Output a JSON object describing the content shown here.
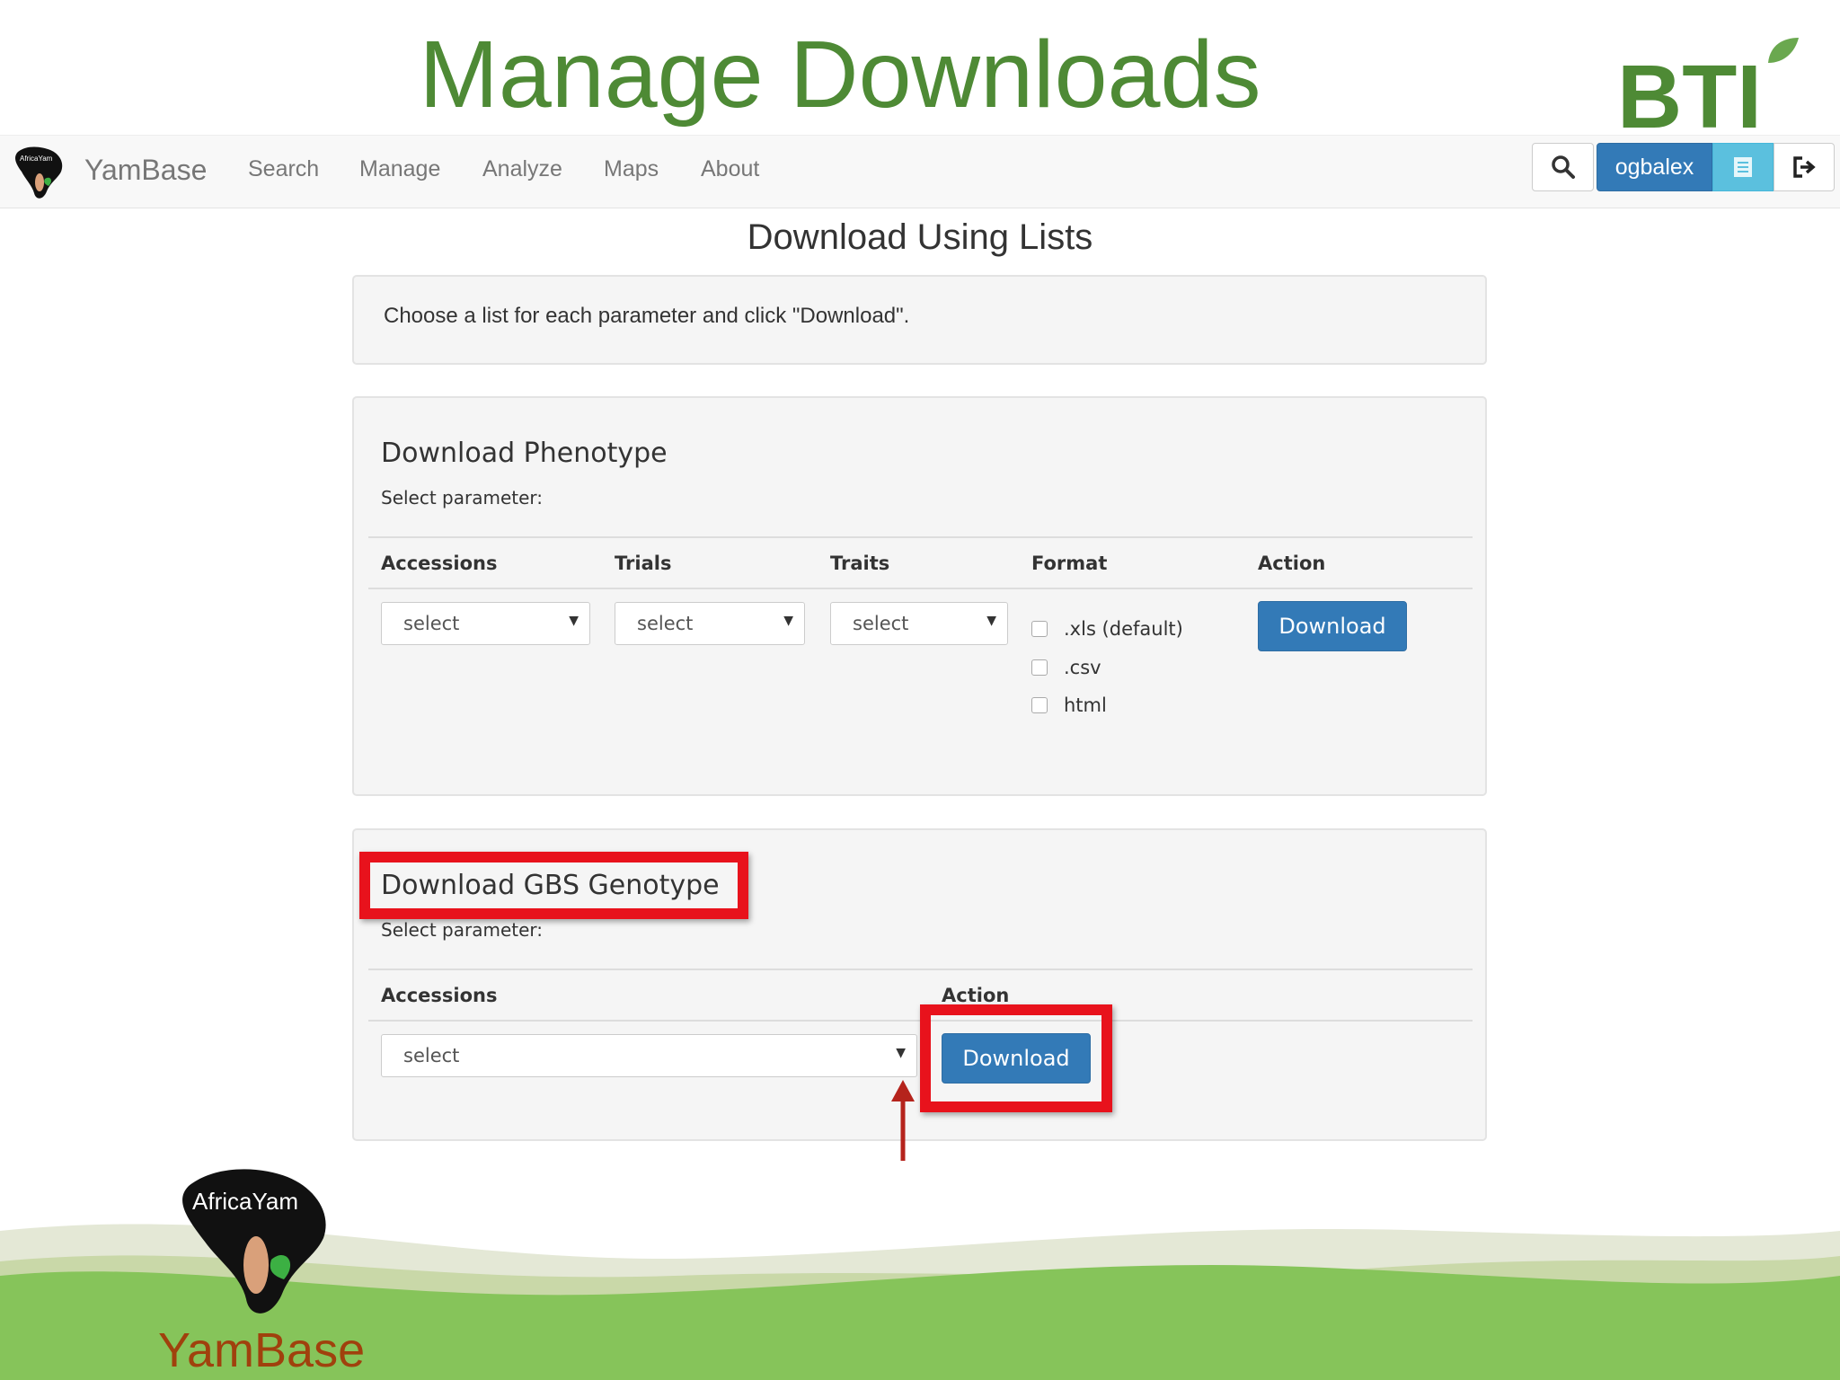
{
  "slide": {
    "title": "Manage Downloads",
    "logo_text": "BTI",
    "footer_label": "YamBase",
    "footer_logo_text": "AfricaYam"
  },
  "navbar": {
    "logo_text": "AfricaYam",
    "brand": "YamBase",
    "links": [
      "Search",
      "Manage",
      "Analyze",
      "Maps",
      "About"
    ],
    "user": "ogbalex",
    "icons": [
      "search-icon",
      "notes-icon",
      "logout-icon"
    ]
  },
  "page": {
    "heading": "Download Using Lists",
    "info": "Choose a list for each parameter and click \"Download\"."
  },
  "phenotype": {
    "title": "Download Phenotype",
    "subtitle": "Select parameter:",
    "columns": [
      "Accessions",
      "Trials",
      "Traits",
      "Format",
      "Action"
    ],
    "selects": [
      "select",
      "select",
      "select"
    ],
    "formats": [
      ".xls (default)",
      ".csv",
      "html"
    ],
    "action_label": "Download"
  },
  "genotype": {
    "title": "Download GBS Genotype",
    "subtitle": "Select parameter:",
    "columns": [
      "Accessions",
      "Action"
    ],
    "select": "select",
    "action_label": "Download"
  },
  "colors": {
    "title_green": "#4e8a35",
    "primary_blue": "#337ab7",
    "highlight_red": "#e8121c",
    "info_blue": "#5bc0de",
    "footer_green": "#86c45a",
    "footer_label": "#a0410d"
  }
}
